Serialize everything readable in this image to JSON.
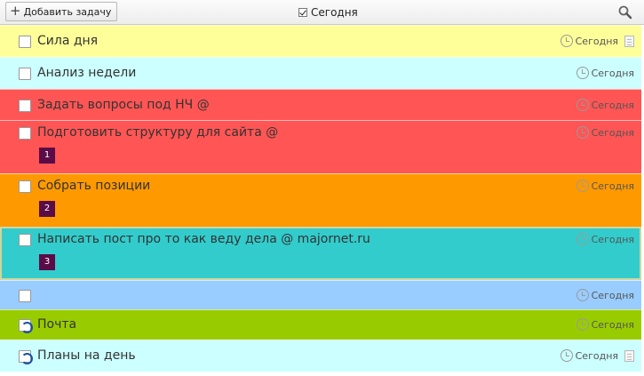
{
  "toolbar": {
    "add_task_label": "Добавить задачу",
    "filter_label": "Сегодня",
    "search_icon": "search-icon"
  },
  "tasks": [
    {
      "title": "Сила дня",
      "hidden_suffix": "",
      "badge": "",
      "date": "Сегодня",
      "color": "#ffff99",
      "has_note": true,
      "recurring": false
    },
    {
      "title": "Анализ недели",
      "hidden_suffix": "",
      "badge": "",
      "date": "Сегодня",
      "color": "#ccffff",
      "has_note": false,
      "recurring": false
    },
    {
      "title": "Задать вопросы под НЧ @",
      "hidden_suffix": "",
      "badge": "",
      "date": "Сегодня",
      "color": "#ff5555",
      "has_note": false,
      "recurring": false
    },
    {
      "title": "Подготовить структуру для сайта @",
      "hidden_suffix": "",
      "badge": "1",
      "date": "Сегодня",
      "color": "#ff5555",
      "has_note": false,
      "recurring": false
    },
    {
      "title": "Собрать позиции",
      "hidden_suffix": "",
      "badge": "2",
      "date": "Сегодня",
      "color": "#ff9900",
      "has_note": false,
      "recurring": false
    },
    {
      "title": "Написать пост про то как веду дела @ majornet.ru",
      "hidden_suffix": "",
      "badge": "3",
      "date": "Сегодня",
      "color": "#33cccc",
      "has_note": false,
      "recurring": false,
      "selected": true
    },
    {
      "title": "",
      "hidden_suffix": "",
      "badge": "",
      "date": "Сегодня",
      "color": "#99ccff",
      "has_note": false,
      "recurring": false
    },
    {
      "title": "Почта",
      "hidden_suffix": "",
      "badge": "",
      "date": "Сегодня",
      "color": "#99cc00",
      "has_note": false,
      "recurring": true
    },
    {
      "title": "Планы на день",
      "hidden_suffix": "",
      "badge": "",
      "date": "Сегодня",
      "color": "#ccffff",
      "has_note": true,
      "recurring": true
    }
  ]
}
